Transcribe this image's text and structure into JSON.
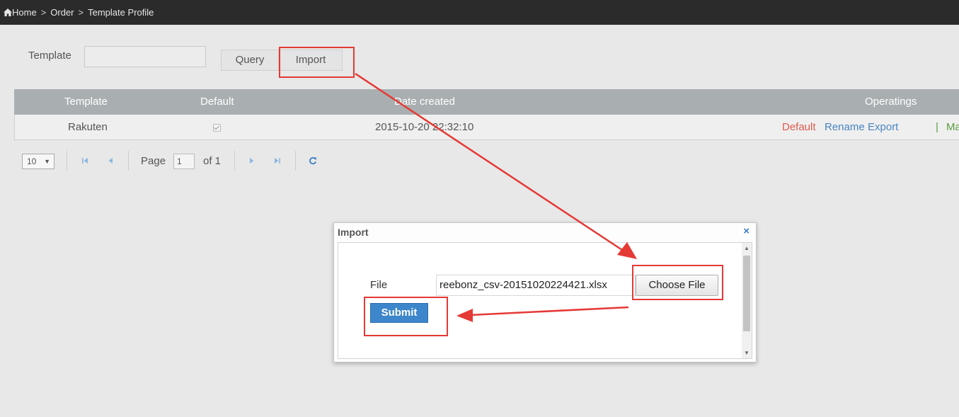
{
  "breadcrumb": {
    "home": "Home",
    "sep": ">",
    "order": "Order",
    "current": "Template Profile"
  },
  "filter": {
    "label": "Template",
    "value": "",
    "query_label": "Query",
    "import_label": "Import"
  },
  "grid": {
    "headers": [
      "Template",
      "Default",
      "Date created",
      "Operatings"
    ],
    "rows": [
      {
        "template": "Rakuten",
        "default_checked": true,
        "date_created": "2015-10-20 22:32:10",
        "ops": {
          "default": "Default",
          "rename": "Rename",
          "export": "Export",
          "divider": "|",
          "more": "Ma"
        }
      }
    ]
  },
  "pager": {
    "page_size": "10",
    "page_label": "Page",
    "page_value": "1",
    "of_label": "of 1"
  },
  "dialog": {
    "title": "Import",
    "close": "×",
    "file_label": "File",
    "file_value": "reebonz_csv-20151020224421.xlsx",
    "choose_label": "Choose File",
    "submit_label": "Submit"
  },
  "colors": {
    "header_bar": "#2b2b2b",
    "grid_header": "#a9afb1",
    "op_default": "#e05a4f",
    "op_link": "#4a84c0",
    "op_more": "#5a9c3c",
    "submit": "#3d86cb",
    "annotation": "#e53935"
  }
}
